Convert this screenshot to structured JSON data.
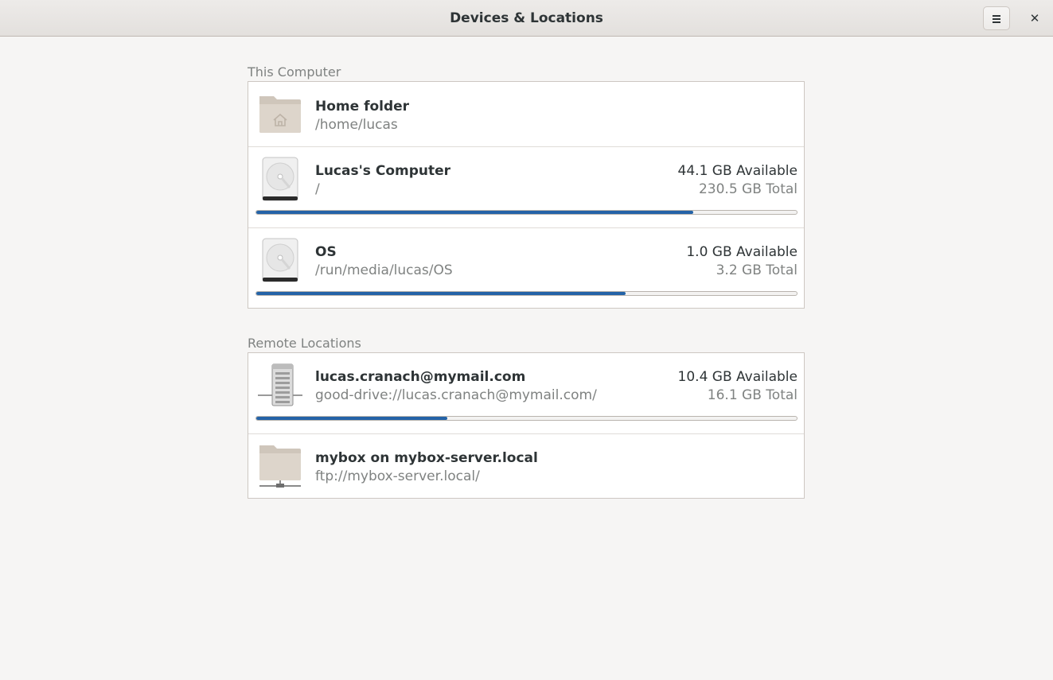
{
  "window": {
    "title": "Devices & Locations"
  },
  "sections": {
    "local": {
      "label": "This Computer",
      "items": [
        {
          "name": "Home folder",
          "path": "/home/lucas",
          "icon": "home-folder-icon"
        },
        {
          "name": "Lucas's Computer",
          "path": "/",
          "available": "44.1 GB Available",
          "total": "230.5 GB Total",
          "usage_fraction": 0.809,
          "icon": "hard-drive-icon"
        },
        {
          "name": "OS",
          "path": "/run/media/lucas/OS",
          "available": "1.0 GB Available",
          "total": "3.2 GB Total",
          "usage_fraction": 0.683,
          "icon": "hard-drive-icon"
        }
      ]
    },
    "remote": {
      "label": "Remote Locations",
      "items": [
        {
          "name": "lucas.cranach@mymail.com",
          "path": "good-drive://lucas.cranach@mymail.com/",
          "available": "10.4 GB Available",
          "total": "16.1 GB Total",
          "usage_fraction": 0.354,
          "icon": "network-server-icon"
        },
        {
          "name": "mybox on mybox-server.local",
          "path": "ftp://mybox-server.local/",
          "icon": "network-folder-icon"
        }
      ]
    }
  },
  "colors": {
    "accent": "#2463a7",
    "background": "#f6f5f4",
    "dim_text": "#7f8281"
  }
}
